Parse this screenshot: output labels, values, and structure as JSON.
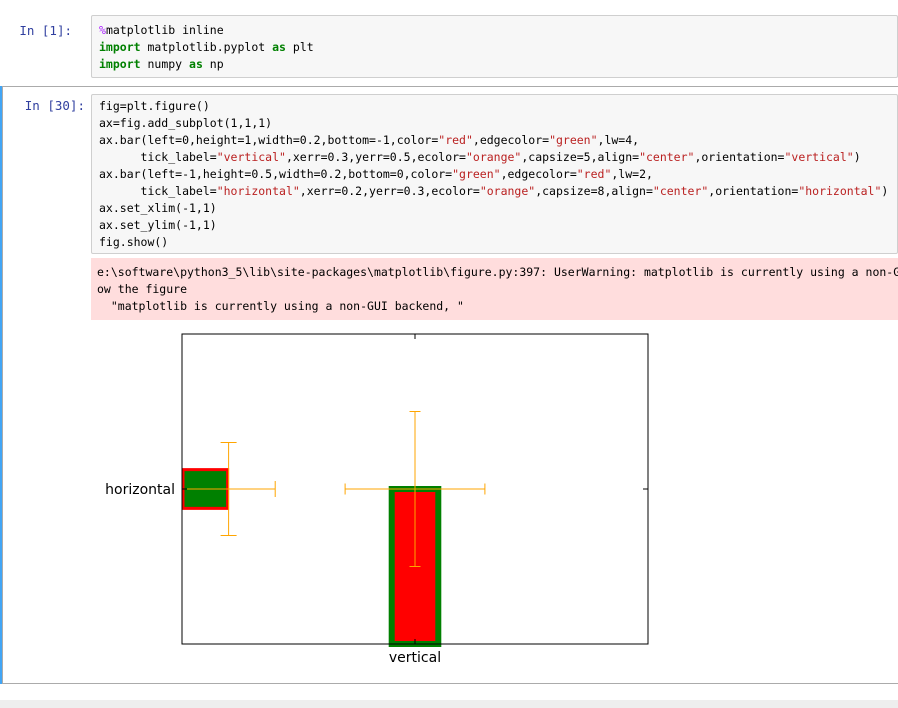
{
  "cell1": {
    "prompt": "In  [1]:",
    "lines": [
      {
        "parts": [
          [
            "magic",
            "%"
          ],
          [
            "plain",
            "matplotlib inline"
          ]
        ]
      },
      {
        "parts": [
          [
            "kw",
            "import"
          ],
          [
            "plain",
            " matplotlib.pyplot "
          ],
          [
            "kw",
            "as"
          ],
          [
            "plain",
            " plt"
          ]
        ]
      },
      {
        "parts": [
          [
            "kw",
            "import"
          ],
          [
            "plain",
            " numpy "
          ],
          [
            "kw",
            "as"
          ],
          [
            "plain",
            " np"
          ]
        ]
      }
    ]
  },
  "cell2": {
    "prompt": "In  [30]:",
    "lines": [
      {
        "parts": [
          [
            "plain",
            "fig=plt.figure()"
          ]
        ]
      },
      {
        "parts": [
          [
            "plain",
            "ax=fig.add_subplot(1,1,1)"
          ]
        ]
      },
      {
        "parts": [
          [
            "plain",
            "ax.bar(left=0,height=1,width=0.2,bottom=-1,color="
          ],
          [
            "str",
            "\"red\""
          ],
          [
            "plain",
            ",edgecolor="
          ],
          [
            "str",
            "\"green\""
          ],
          [
            "plain",
            ",lw=4,"
          ]
        ]
      },
      {
        "parts": [
          [
            "plain",
            "      tick_label="
          ],
          [
            "str",
            "\"vertical\""
          ],
          [
            "plain",
            ",xerr=0.3,yerr=0.5,ecolor="
          ],
          [
            "str",
            "\"orange\""
          ],
          [
            "plain",
            ",capsize=5,align="
          ],
          [
            "str",
            "\"center\""
          ],
          [
            "plain",
            ",orientation="
          ],
          [
            "str",
            "\"vertical\""
          ],
          [
            "plain",
            ")"
          ]
        ]
      },
      {
        "parts": [
          [
            "plain",
            "ax.bar(left=-1,height=0.5,width=0.2,bottom=0,color="
          ],
          [
            "str",
            "\"green\""
          ],
          [
            "plain",
            ",edgecolor="
          ],
          [
            "str",
            "\"red\""
          ],
          [
            "plain",
            ",lw=2,"
          ]
        ]
      },
      {
        "parts": [
          [
            "plain",
            "      tick_label="
          ],
          [
            "str",
            "\"horizontal\""
          ],
          [
            "plain",
            ",xerr=0.2,yerr=0.3,ecolor="
          ],
          [
            "str",
            "\"orange\""
          ],
          [
            "plain",
            ",capsize=8,align="
          ],
          [
            "str",
            "\"center\""
          ],
          [
            "plain",
            ",orientation="
          ],
          [
            "str",
            "\"horizontal\""
          ],
          [
            "plain",
            ")"
          ]
        ]
      },
      {
        "parts": [
          [
            "plain",
            "ax.set_xlim(-1,1)"
          ]
        ]
      },
      {
        "parts": [
          [
            "plain",
            "ax.set_ylim(-1,1)"
          ]
        ]
      },
      {
        "parts": [
          [
            "plain",
            "fig.show()"
          ]
        ]
      }
    ],
    "stderr": [
      "e:\\software\\python3_5\\lib\\site-packages\\matplotlib\\figure.py:397: UserWarning: matplotlib is currently using a non-GUI backend, so cannot sh",
      "ow the figure",
      "  \"matplotlib is currently using a non-GUI backend, \""
    ]
  },
  "chart_data": {
    "type": "bar",
    "xlim": [
      -1,
      1
    ],
    "ylim": [
      -1,
      1
    ],
    "grid": false,
    "bars": [
      {
        "name": "vertical",
        "orientation": "vertical",
        "x": 0,
        "bottom": -1,
        "height": 1,
        "width": 0.2,
        "color": "#ff0000",
        "edgecolor": "#008000",
        "xerr": 0.3,
        "yerr": 0.5,
        "ecolor": "#ffa500"
      },
      {
        "name": "horizontal",
        "orientation": "horizontal",
        "y": 0,
        "left": -1,
        "length": 0.2,
        "thickness": 0.5,
        "color": "#008000",
        "edgecolor": "#ff0000",
        "xerr": 0.2,
        "yerr": 0.3,
        "ecolor": "#ffa500"
      }
    ],
    "xtick_labels": [
      "vertical"
    ],
    "ytick_labels": [
      "horizontal"
    ]
  }
}
